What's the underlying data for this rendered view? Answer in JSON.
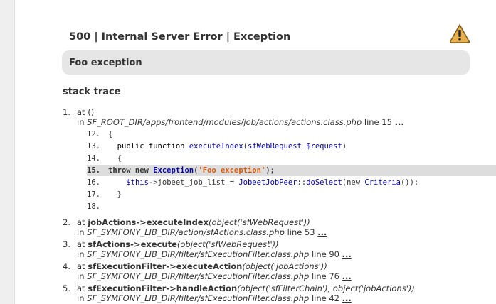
{
  "header": {
    "title": "500 | Internal Server Error | Exception"
  },
  "error": {
    "message": "Foo exception"
  },
  "stack": {
    "heading": "stack trace",
    "items": [
      {
        "num": "1.",
        "prefix": "at ()",
        "fn": "",
        "args": "",
        "in": "in",
        "path": "SF_ROOT_DIR/apps/frontend/modules/job/actions/actions.class.php",
        "line": "line 15",
        "link": "..."
      },
      {
        "num": "2.",
        "prefix": "at",
        "fn": "jobActions->executeIndex",
        "args": "(object('sfWebRequest'))",
        "in": "in",
        "path": "SF_SYMFONY_LIB_DIR/action/sfActions.class.php",
        "line": "line 53",
        "link": "..."
      },
      {
        "num": "3.",
        "prefix": "at",
        "fn": "sfActions->execute",
        "args": "(object('sfWebRequest'))",
        "in": "in",
        "path": "SF_SYMFONY_LIB_DIR/filter/sfExecutionFilter.class.php",
        "line": "line 90",
        "link": "..."
      },
      {
        "num": "4.",
        "prefix": "at",
        "fn": "sfExecutionFilter->executeAction",
        "args": "(object('jobActions'))",
        "in": "in",
        "path": "SF_SYMFONY_LIB_DIR/filter/sfExecutionFilter.class.php",
        "line": "line 76",
        "link": "..."
      },
      {
        "num": "5.",
        "prefix": "at",
        "fn": "sfExecutionFilter->handleAction",
        "args": "(object('sfFilterChain'), object('jobActions'))",
        "in": "in",
        "path": "SF_SYMFONY_LIB_DIR/filter/sfExecutionFilter.class.php",
        "line": "line 42",
        "link": "..."
      }
    ]
  },
  "code": {
    "lines": [
      {
        "n": "12.",
        "text": "{"
      },
      {
        "n": "13.",
        "text": "  public function executeIndex(sfWebRequest $request)"
      },
      {
        "n": "14.",
        "text": "  {"
      },
      {
        "n": "15.",
        "text": "throw new Exception('Foo exception');"
      },
      {
        "n": "16.",
        "text": "    $this->jobeet_job_list = JobeetJobPeer::doSelect(new Criteria());"
      },
      {
        "n": "17.",
        "text": "  }"
      },
      {
        "n": "18.",
        "text": ""
      }
    ]
  },
  "icons": {
    "warning": "warning-icon"
  },
  "colors": {
    "highlight": "#dddddd",
    "message_bg": "#e6e6e6",
    "function": "#0000bb",
    "string": "#dd5500"
  }
}
